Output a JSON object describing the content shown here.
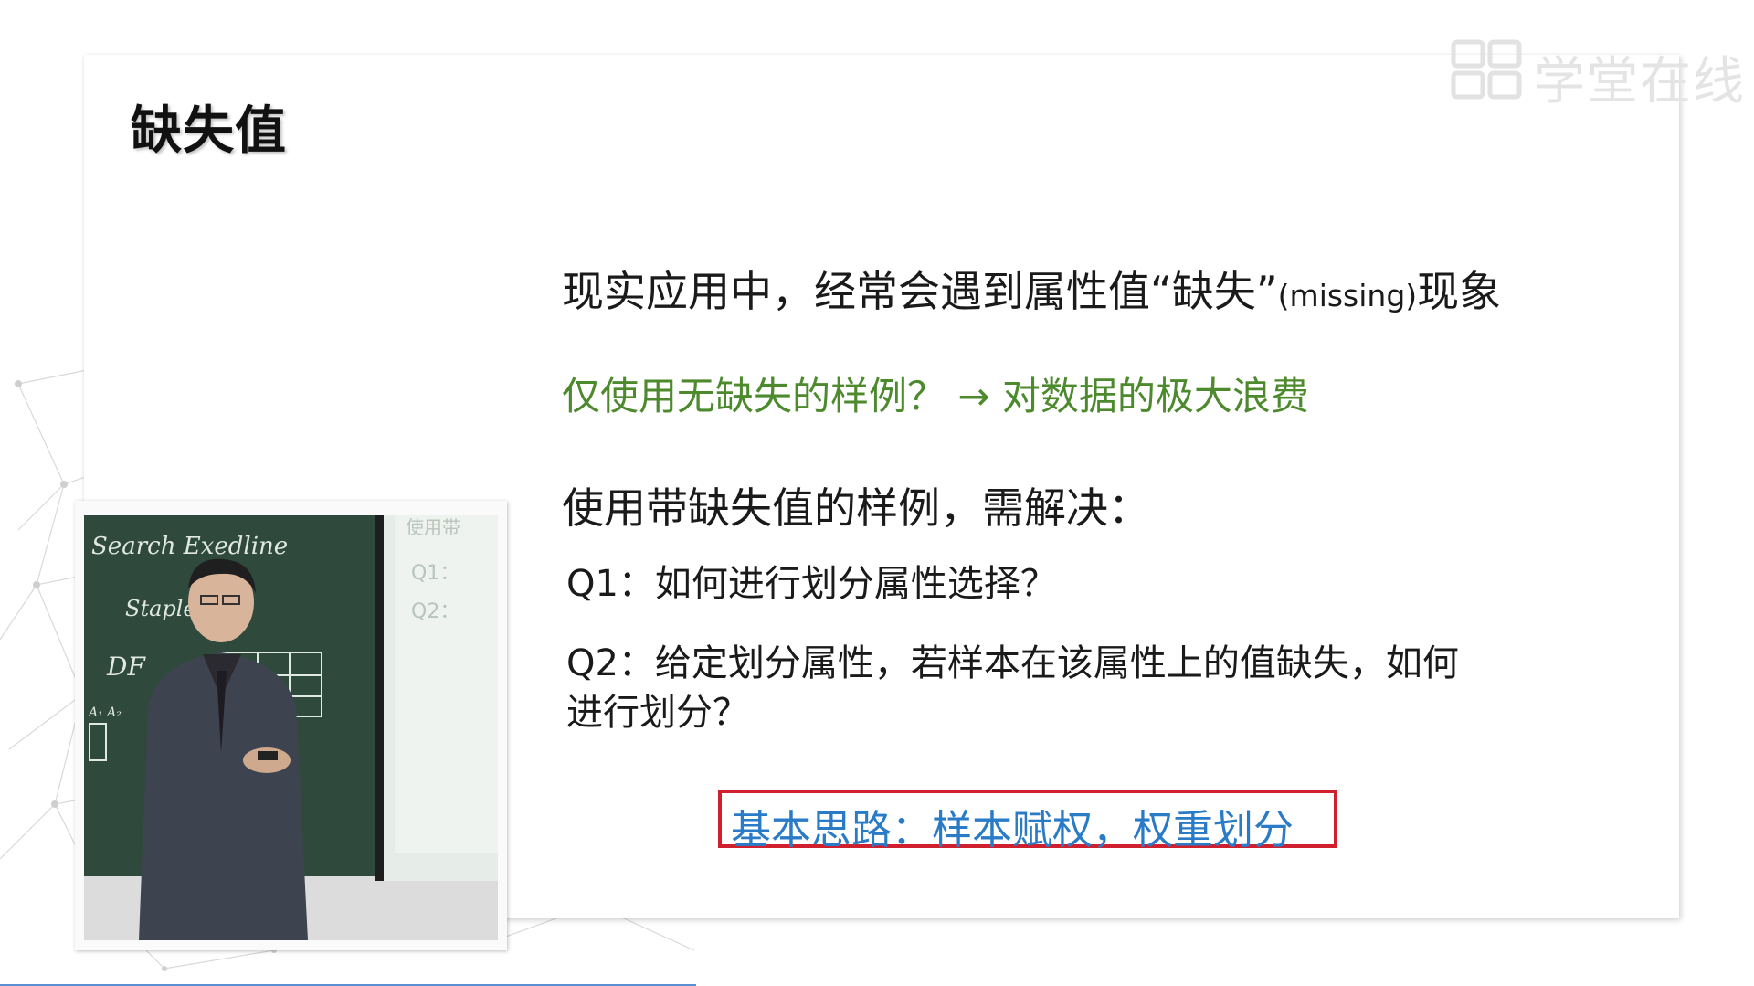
{
  "watermark": {
    "icon": "xuetangx-logo-icon",
    "text": "学堂在线"
  },
  "slide": {
    "title": "缺失值",
    "intro_main": "现实应用中，经常会遇到属性值“缺失”",
    "intro_small": "(missing)",
    "intro_tail": "现象",
    "green_line": "仅使用无缺失的样例？ → 对数据的极大浪费",
    "use_line": "使用带缺失值的样例，需解决：",
    "q1": "Q1：如何进行划分属性选择？",
    "q2_line1": "Q2：给定划分属性，若样本在该属性上的值缺失，如何",
    "q2_line2": "进行划分？",
    "idea": "基本思路：样本赋权，权重划分"
  },
  "video": {
    "board_text": [
      "Search Exedline",
      "Staple",
      "DF",
      "A₁ A₂"
    ],
    "screen_text": [
      "使用带",
      "Q1：",
      "Q2："
    ]
  },
  "colors": {
    "green": "#4d8a2e",
    "idea_blue": "#2a7bc7",
    "box_red": "#d0202e",
    "chalkboard": "#2f4a3c"
  }
}
